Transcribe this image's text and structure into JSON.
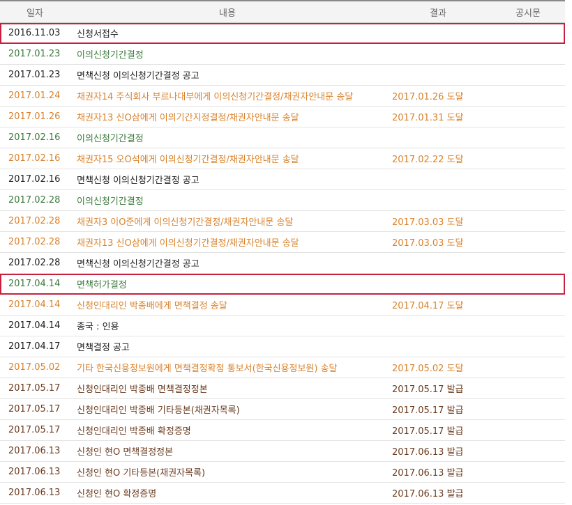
{
  "header": {
    "date_label": "일자",
    "content_label": "내용",
    "result_label": "결과",
    "notice_label": "공시문"
  },
  "colors": {
    "black": "#1f1f1f",
    "green": "#3b7a3b",
    "orange": "#d9822b",
    "brown": "#6a3b1e",
    "highlight": "#c8203f"
  },
  "rows": [
    {
      "date": "2016.11.03",
      "content": "신청서접수",
      "result": "",
      "color": "black",
      "highlight": true
    },
    {
      "date": "2017.01.23",
      "content": "이의신청기간결정",
      "result": "",
      "color": "green",
      "highlight": false
    },
    {
      "date": "2017.01.23",
      "content": "면책신청 이의신청기간결정 공고",
      "result": "",
      "color": "black",
      "highlight": false
    },
    {
      "date": "2017.01.24",
      "content": "채권자14 주식회사 부르나대부에게 이의신청기간결정/채권자안내문 송달",
      "result": "2017.01.26 도달",
      "color": "orange",
      "highlight": false
    },
    {
      "date": "2017.01.26",
      "content": "채권자13 신O삼에게 이의기간지정결정/채권자안내문 송달",
      "result": "2017.01.31 도달",
      "color": "orange",
      "highlight": false
    },
    {
      "date": "2017.02.16",
      "content": "이의신청기간결정",
      "result": "",
      "color": "green",
      "highlight": false
    },
    {
      "date": "2017.02.16",
      "content": "채권자15 오O석에게 이의신청기간결정/채권자안내문 송달",
      "result": "2017.02.22 도달",
      "color": "orange",
      "highlight": false
    },
    {
      "date": "2017.02.16",
      "content": "면책신청 이의신청기간결정 공고",
      "result": "",
      "color": "black",
      "highlight": false
    },
    {
      "date": "2017.02.28",
      "content": "이의신청기간결정",
      "result": "",
      "color": "green",
      "highlight": false
    },
    {
      "date": "2017.02.28",
      "content": "채권자3 이O준에게 이의신청기간결정/채권자안내문 송달",
      "result": "2017.03.03 도달",
      "color": "orange",
      "highlight": false
    },
    {
      "date": "2017.02.28",
      "content": "채권자13 신O삼에게 이의신청기간결정/채권자안내문 송달",
      "result": "2017.03.03 도달",
      "color": "orange",
      "highlight": false
    },
    {
      "date": "2017.02.28",
      "content": "면책신청 이의신청기간결정 공고",
      "result": "",
      "color": "black",
      "highlight": false
    },
    {
      "date": "2017.04.14",
      "content": "면책허가결정",
      "result": "",
      "color": "green",
      "highlight": true
    },
    {
      "date": "2017.04.14",
      "content": "신청인대리인 박종배에게 면책결정 송달",
      "result": "2017.04.17 도달",
      "color": "orange",
      "highlight": false
    },
    {
      "date": "2017.04.14",
      "content": "종국 : 인용",
      "result": "",
      "color": "black",
      "highlight": false
    },
    {
      "date": "2017.04.17",
      "content": "면책결정 공고",
      "result": "",
      "color": "black",
      "highlight": false
    },
    {
      "date": "2017.05.02",
      "content": "기타 한국신용정보원에게 면책결정확정 통보서(한국신용정보원) 송달",
      "result": "2017.05.02 도달",
      "color": "orange",
      "highlight": false
    },
    {
      "date": "2017.05.17",
      "content": "신청인대리인 박종배 면책결정정본",
      "result": "2017.05.17 발급",
      "color": "brown",
      "highlight": false
    },
    {
      "date": "2017.05.17",
      "content": "신청인대리인 박종배 기타등본(채권자목록)",
      "result": "2017.05.17 발급",
      "color": "brown",
      "highlight": false
    },
    {
      "date": "2017.05.17",
      "content": "신청인대리인 박종배 확정증명",
      "result": "2017.05.17 발급",
      "color": "brown",
      "highlight": false
    },
    {
      "date": "2017.06.13",
      "content": "신청인 현O 면책결정정본",
      "result": "2017.06.13 발급",
      "color": "brown",
      "highlight": false
    },
    {
      "date": "2017.06.13",
      "content": "신청인 현O 기타등본(채권자목록)",
      "result": "2017.06.13 발급",
      "color": "brown",
      "highlight": false
    },
    {
      "date": "2017.06.13",
      "content": "신청인 현O 확정증명",
      "result": "2017.06.13 발급",
      "color": "brown",
      "highlight": false
    }
  ]
}
